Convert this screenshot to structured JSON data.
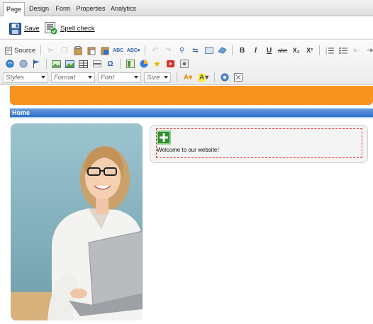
{
  "tabs": [
    {
      "label": "Page",
      "active": true
    },
    {
      "label": "Design",
      "active": false
    },
    {
      "label": "Form",
      "active": false
    },
    {
      "label": "Properties",
      "active": false
    },
    {
      "label": "Analytics",
      "active": false
    }
  ],
  "actions": {
    "save_label": "Save",
    "spellcheck_label": "Spell check"
  },
  "toolbar": {
    "source_label": "Source",
    "combos": {
      "styles": "Styles",
      "format": "Format",
      "font": "Font",
      "size": "Size"
    },
    "bold": "B",
    "italic": "I",
    "underline": "U",
    "strike": "abe",
    "subscript": "X₂",
    "superscript": "X²"
  },
  "page": {
    "nav_home": "Home",
    "welcome_text": "Welcome to our website!"
  },
  "colors": {
    "accent_orange": "#f7931e",
    "nav_blue": "#2e6fc7",
    "editable_border": "#e03a3a"
  }
}
